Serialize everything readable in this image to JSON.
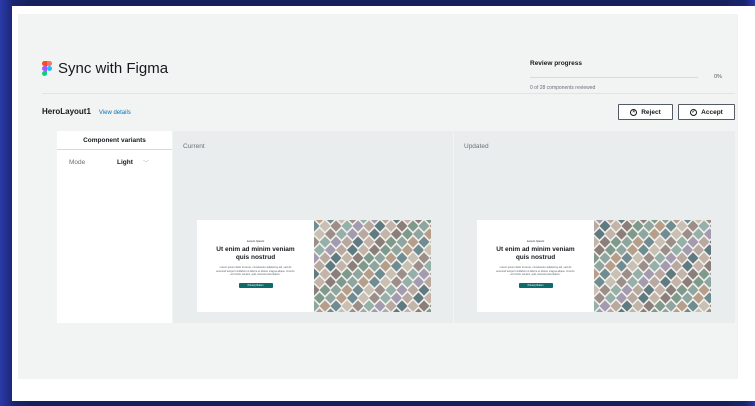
{
  "header": {
    "title": "Sync with Figma"
  },
  "review": {
    "label": "Review progress",
    "percent_text": "0%",
    "progress": 0,
    "summary": "0 of 28 components reviewed"
  },
  "layout": {
    "name": "HeroLayout1",
    "details_link": "View details"
  },
  "actions": {
    "reject_label": "Reject",
    "accept_label": "Accept"
  },
  "sidebar": {
    "title": "Component variants",
    "mode_label": "Mode",
    "mode_value": "Light"
  },
  "panes": {
    "current_label": "Current",
    "updated_label": "Updated"
  },
  "preview": {
    "eyebrow": "Lorem Ipsum",
    "heading": "Ut enim ad minim veniam quis nostrud",
    "body": "Lorem ipsum dolor sit amet, consectetur adipiscing elit, sed do eiusmod tempor incididunt ut labore et dolore magna aliqua. Ut enim ad minim veniam, quis nostrud exercitation.",
    "button_label": "Primary Button"
  },
  "colors": {
    "accent": "#0073bb",
    "cta": "#0f6b6b",
    "panel": "#f2f3f3",
    "backdrop": "#1b2a6b"
  },
  "icons": {
    "app": "figma-logo-icon",
    "reject": "x-circle-icon",
    "accept": "check-circle-icon",
    "dropdown": "chevron-down-icon"
  }
}
